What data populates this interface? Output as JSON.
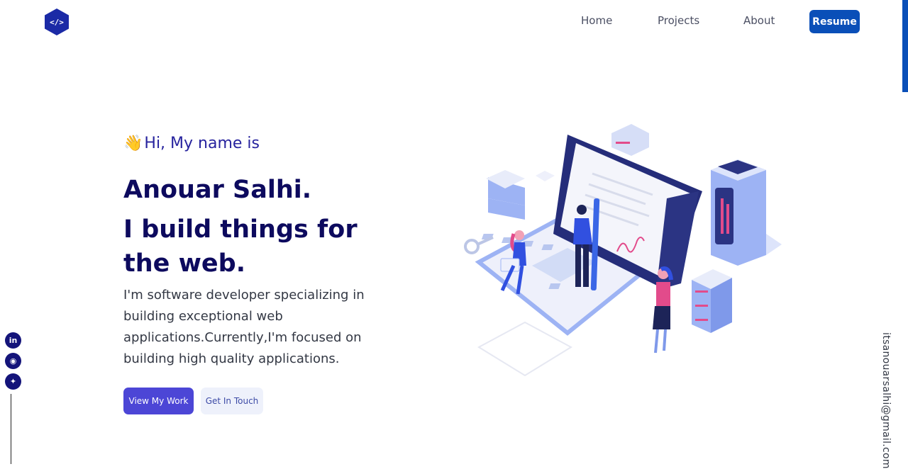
{
  "header": {
    "logo_text": "</>",
    "nav": [
      "Home",
      "Projects",
      "About"
    ],
    "resume_label": "Resume"
  },
  "hero": {
    "greeting_emoji": "👋",
    "greeting": "Hi, My name is",
    "name": "Anouar Salhi.",
    "tagline": "I build things for the web.",
    "description": "I'm software developer specializing in building exceptional web applications.Currently,I'm focused on building high quality applications.",
    "primary_button": "View My Work",
    "secondary_button": "Get In Touch"
  },
  "social": [
    {
      "name": "linkedin",
      "glyph": "in"
    },
    {
      "name": "github",
      "glyph": "◉"
    },
    {
      "name": "twitter",
      "glyph": "✦"
    }
  ],
  "email": "itsanouarsalhi@gmail.com",
  "colors": {
    "brand": "#0a4fb8",
    "heading": "#0d0a5e",
    "primary_button": "#4c46d6"
  }
}
